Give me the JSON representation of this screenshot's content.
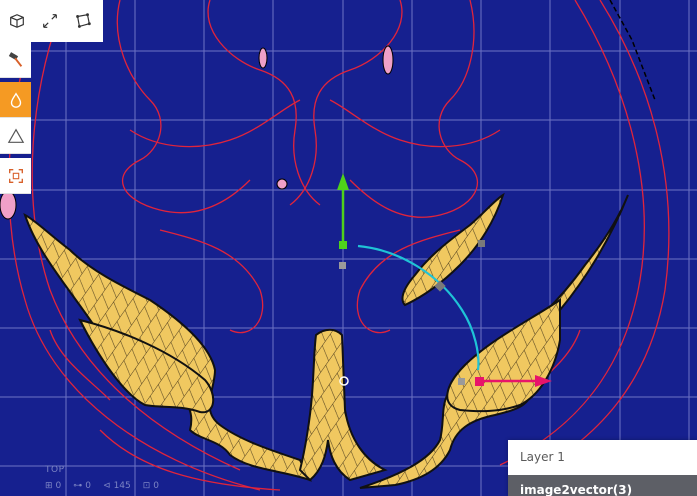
{
  "toolbar": {
    "items": [
      {
        "name": "cube-view-icon"
      },
      {
        "name": "expand-arrows-icon"
      },
      {
        "name": "polygon-select-icon"
      }
    ]
  },
  "side_toolbar": {
    "items": [
      {
        "name": "hammer-icon",
        "active": false
      },
      {
        "name": "droplet-icon",
        "active": true
      },
      {
        "name": "triangle-icon",
        "active": false
      },
      {
        "name": "fit-view-icon",
        "active": false
      }
    ]
  },
  "viewport": {
    "view_label": "TOP",
    "stats": {
      "objects": "0",
      "edges": "0",
      "vertices": "145",
      "faces": "0"
    }
  },
  "layers": {
    "items": [
      {
        "label": "Layer 1",
        "selected": false
      },
      {
        "label": "image2vector(3)",
        "selected": true
      }
    ]
  },
  "colors": {
    "background": "#16208f",
    "grid": "#8a8fd6",
    "outline": "#e0243c",
    "fill": "#f0c860",
    "active_tool": "#f59a23",
    "axis_y": "#4fd21a",
    "axis_x": "#e8146a",
    "rotate_arc": "#1fc3d6"
  }
}
